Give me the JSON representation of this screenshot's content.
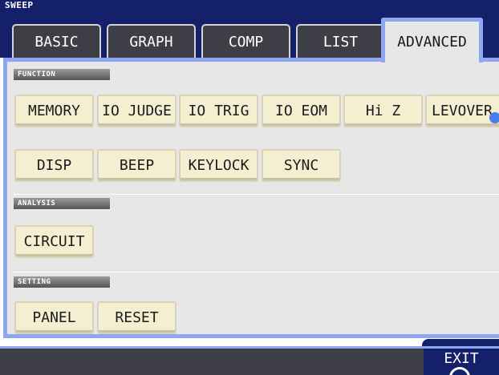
{
  "screen": {
    "title": "SWEEP"
  },
  "tabs": [
    {
      "label": "BASIC",
      "active": false
    },
    {
      "label": "GRAPH",
      "active": false
    },
    {
      "label": "COMP",
      "active": false
    },
    {
      "label": "LIST",
      "active": false
    },
    {
      "label": "ADVANCED",
      "active": true
    }
  ],
  "sections": {
    "function": {
      "title": "FUNCTION",
      "buttons": [
        "MEMORY",
        "IO JUDGE",
        "IO TRIG",
        "IO EOM",
        "Hi Z",
        "LEVOVER",
        "DISP",
        "BEEP",
        "KEYLOCK",
        "SYNC"
      ]
    },
    "analysis": {
      "title": "ANALYSIS",
      "buttons": [
        "CIRCUIT"
      ]
    },
    "setting": {
      "title": "SETTING",
      "buttons": [
        "PANEL",
        "RESET"
      ]
    }
  },
  "footer": {
    "exit_label": "EXIT"
  },
  "colors": {
    "header_bg": "#14206a",
    "panel_bg": "#e7e7e7",
    "highlight_border": "#8fa6f0",
    "button_bg": "#f5efd2",
    "footer_bg": "#3e3e46"
  }
}
